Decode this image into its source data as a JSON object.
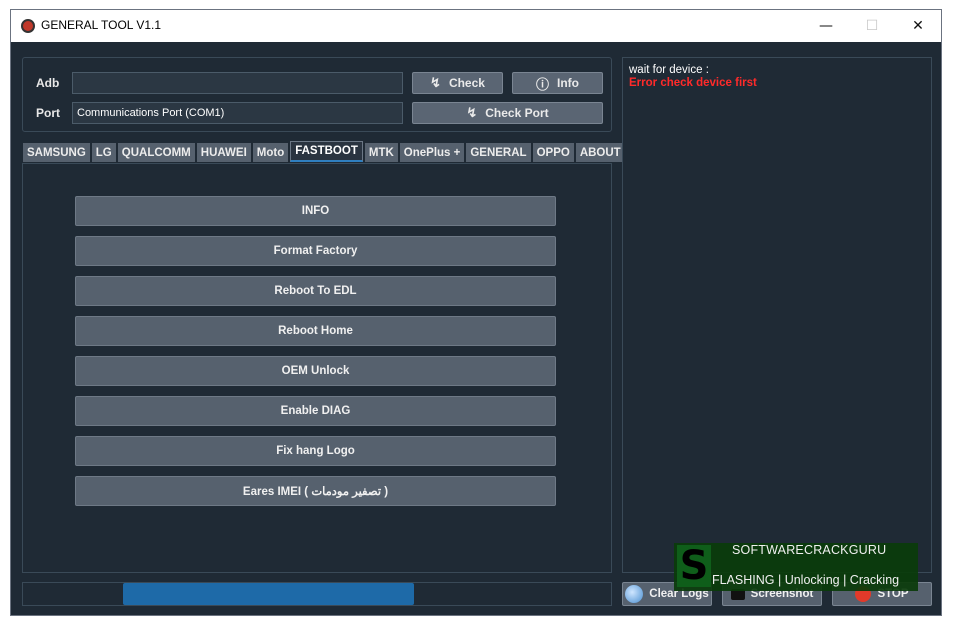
{
  "window": {
    "title": "GENERAL TOOL V1.1",
    "minimize_icon": "minimize-icon",
    "maximize_icon": "maximize-icon",
    "close_icon": "close-icon"
  },
  "connection": {
    "adb_label": "Adb",
    "adb_value": "",
    "port_label": "Port",
    "port_value": "Communications Port (COM1)",
    "check_button": "Check",
    "info_button": "Info",
    "check_port_button": "Check Port"
  },
  "tabs": [
    "SAMSUNG",
    "LG",
    "QUALCOMM",
    "HUAWEI",
    "Moto",
    "FASTBOOT",
    "MTK",
    "OnePlus +",
    "GENERAL",
    "OPPO",
    "ABOUT"
  ],
  "active_tab": "FASTBOOT",
  "actions": [
    "INFO",
    "Format Factory",
    "Reboot To EDL",
    "Reboot Home",
    "OEM Unlock",
    "Enable DIAG",
    "Fix hang Logo",
    "Eares IMEI ( تصفير مودمات )"
  ],
  "log": {
    "line1": "wait for device :",
    "line2": "Error check device first"
  },
  "bottom": {
    "clear_logs": "Clear Logs",
    "screenshot": "Screenshot",
    "stop": "STOP"
  },
  "progress": {
    "value_fraction": 0.5
  },
  "watermark": {
    "letter": "S",
    "top": "SOFTWARECRACKGURU",
    "bottom": "FLASHING | Unlocking | Cracking"
  },
  "colors": {
    "background": "#1f2a35",
    "button": "#56616e",
    "progress": "#1e6aa8",
    "error_text": "#ff2a2a"
  }
}
